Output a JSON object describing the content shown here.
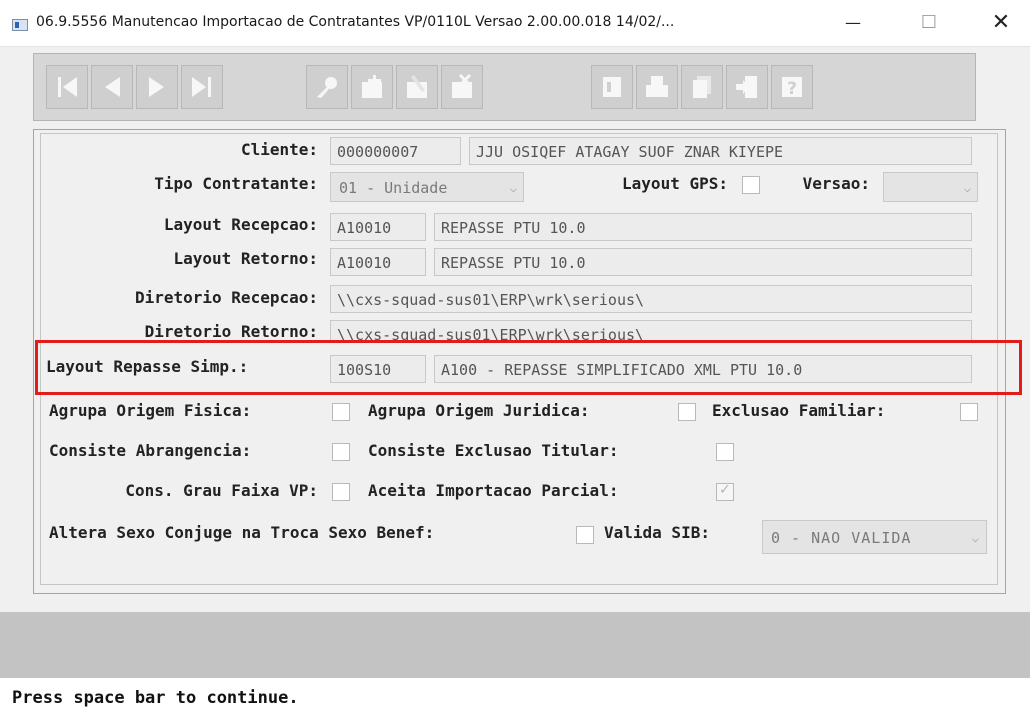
{
  "window": {
    "title": "06.9.5556 Manutencao  Importacao de Contratantes  VP/0110L Versao 2.00.00.018 14/02/...",
    "minimize": "—",
    "maximize": "☐",
    "close": "✕"
  },
  "toolbar": {
    "groups": [
      [
        {
          "name": "first-record",
          "icon": "first-icon"
        },
        {
          "name": "previous-record",
          "icon": "prev-icon"
        },
        {
          "name": "next-record",
          "icon": "next-icon"
        },
        {
          "name": "last-record",
          "icon": "last-icon"
        }
      ],
      [
        {
          "name": "search",
          "icon": "key-search-icon"
        },
        {
          "name": "add",
          "icon": "add-icon"
        },
        {
          "name": "edit",
          "icon": "edit-icon"
        },
        {
          "name": "delete",
          "icon": "delete-icon"
        }
      ],
      [
        {
          "name": "filter",
          "icon": "filter-icon"
        },
        {
          "name": "print",
          "icon": "print-icon"
        },
        {
          "name": "copy",
          "icon": "copy-icon"
        },
        {
          "name": "go-to",
          "icon": "goto-icon"
        },
        {
          "name": "help",
          "icon": "help-icon"
        }
      ]
    ]
  },
  "form": {
    "cliente": {
      "label": "Cliente:",
      "code": "000000007",
      "name": "JJU OSIQEF ATAGAY SUOF ZNAR KIYEPE"
    },
    "tipo_contratante": {
      "label": "Tipo Contratante:",
      "value": "01 - Unidade"
    },
    "layout_gps": {
      "label": "Layout GPS:",
      "checked": false
    },
    "versao": {
      "label": "Versao:",
      "value": ""
    },
    "layout_recepcao": {
      "label": "Layout Recepcao:",
      "code": "A10010",
      "desc": "REPASSE PTU 10.0"
    },
    "layout_retorno": {
      "label": "Layout Retorno:",
      "code": "A10010",
      "desc": "REPASSE PTU 10.0"
    },
    "diretorio_recepcao": {
      "label": "Diretorio Recepcao:",
      "value": "\\\\cxs-squad-sus01\\ERP\\wrk\\serious\\"
    },
    "diretorio_retorno": {
      "label": "Diretorio Retorno:",
      "value": "\\\\cxs-squad-sus01\\ERP\\wrk\\serious\\"
    },
    "layout_repasse_simp": {
      "label": "Layout Repasse Simp.:",
      "code": "100S10",
      "desc": "A100 - REPASSE SIMPLIFICADO XML PTU 10.0"
    },
    "agrupa_origem_fisica": {
      "label": "Agrupa Origem Fisica:",
      "checked": false
    },
    "agrupa_origem_juridica": {
      "label": "Agrupa Origem Juridica:",
      "checked": false
    },
    "exclusao_familiar": {
      "label": "Exclusao Familiar:",
      "checked": false
    },
    "consiste_abrangencia": {
      "label": "Consiste Abrangencia:",
      "checked": false
    },
    "consiste_exclusao_titular": {
      "label": "Consiste Exclusao Titular:",
      "checked": false
    },
    "cons_grau_faixa_vp": {
      "label": "Cons. Grau Faixa VP:",
      "checked": false
    },
    "aceita_importacao_parcial": {
      "label": "Aceita Importacao Parcial:",
      "checked": true
    },
    "altera_sexo_conjuge": {
      "label": "Altera Sexo Conjuge na Troca Sexo Benef:",
      "checked": false
    },
    "valida_sib": {
      "label": "Valida SIB:",
      "value": "0 - NAO VALIDA"
    }
  },
  "status": {
    "message": "Press space bar to continue."
  },
  "colors": {
    "highlight": "#e21b1b"
  }
}
